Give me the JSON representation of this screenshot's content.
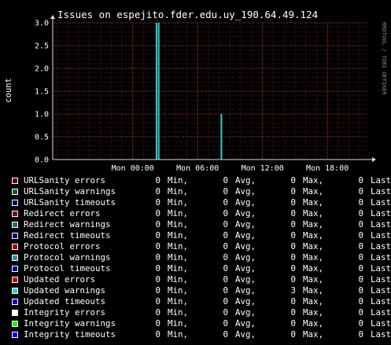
{
  "chart_data": {
    "type": "line",
    "title": "Issues on espejito.fder.edu.uy_190.64.49.124",
    "ylabel": "count",
    "ylim": [
      0,
      3
    ],
    "yticks": [
      "0.0",
      "0.5",
      "1.0",
      "1.5",
      "2.0",
      "2.5",
      "3.0"
    ],
    "xlim_hours": [
      -7.4,
      21.7
    ],
    "xticks": [
      {
        "label": "Mon 00:00",
        "hour": 0
      },
      {
        "label": "Mon 06:00",
        "hour": 6
      },
      {
        "label": "Mon 12:00",
        "hour": 12
      },
      {
        "label": "Mon 18:00",
        "hour": 18
      }
    ],
    "grid": true,
    "series": [
      {
        "name": "Updated warnings",
        "color": "#33cccc",
        "spikes": [
          {
            "hour": 2.2,
            "value": 3.0
          },
          {
            "hour": 2.4,
            "value": 3.0
          },
          {
            "hour": 8.2,
            "value": 1.0
          }
        ]
      }
    ]
  },
  "watermark": "RRDTOOL / TOBI OETIKER",
  "legend": [
    {
      "label": "URLSanity errors",
      "color": "#660000",
      "min": "0",
      "avg": "0",
      "max": "0",
      "last": "0"
    },
    {
      "label": "URLSanity warnings",
      "color": "#006633",
      "min": "0",
      "avg": "0",
      "max": "0",
      "last": "0"
    },
    {
      "label": "URLSanity timeouts",
      "color": "#000066",
      "min": "0",
      "avg": "0",
      "max": "0",
      "last": "0"
    },
    {
      "label": "Redirect errors",
      "color": "#880000",
      "min": "0",
      "avg": "0",
      "max": "0",
      "last": "0"
    },
    {
      "label": "Redirect warnings",
      "color": "#117777",
      "min": "0",
      "avg": "0",
      "max": "0",
      "last": "0"
    },
    {
      "label": "Redirect timeouts",
      "color": "#000088",
      "min": "0",
      "avg": "0",
      "max": "0",
      "last": "0"
    },
    {
      "label": "Protocol errors",
      "color": "#aa0000",
      "min": "0",
      "avg": "0",
      "max": "0",
      "last": "0"
    },
    {
      "label": "Protocol warnings",
      "color": "#229999",
      "min": "0",
      "avg": "0",
      "max": "0",
      "last": "0"
    },
    {
      "label": "Protocol timeouts",
      "color": "#0000aa",
      "min": "0",
      "avg": "0",
      "max": "0",
      "last": "0"
    },
    {
      "label": "Updated errors",
      "color": "#cc0000",
      "min": "0",
      "avg": "0",
      "max": "0",
      "last": "0"
    },
    {
      "label": "Updated warnings",
      "color": "#33cccc",
      "min": "0",
      "avg": "0",
      "max": "3",
      "last": "0"
    },
    {
      "label": "Updated timeouts",
      "color": "#0000cc",
      "min": "0",
      "avg": "0",
      "max": "0",
      "last": "0"
    },
    {
      "label": "Integrity errors",
      "color": "#ffffff",
      "min": "0",
      "avg": "0",
      "max": "0",
      "last": "0"
    },
    {
      "label": "Integrity warnings",
      "color": "#00ff00",
      "min": "0",
      "avg": "0",
      "max": "0",
      "last": "0"
    },
    {
      "label": "Integrity timeouts",
      "color": "#0000ff",
      "min": "0",
      "avg": "0",
      "max": "0",
      "last": "0"
    }
  ],
  "legend_units": {
    "min": "Min,",
    "avg": "Avg,",
    "max": "Max,",
    "last": "Last"
  }
}
